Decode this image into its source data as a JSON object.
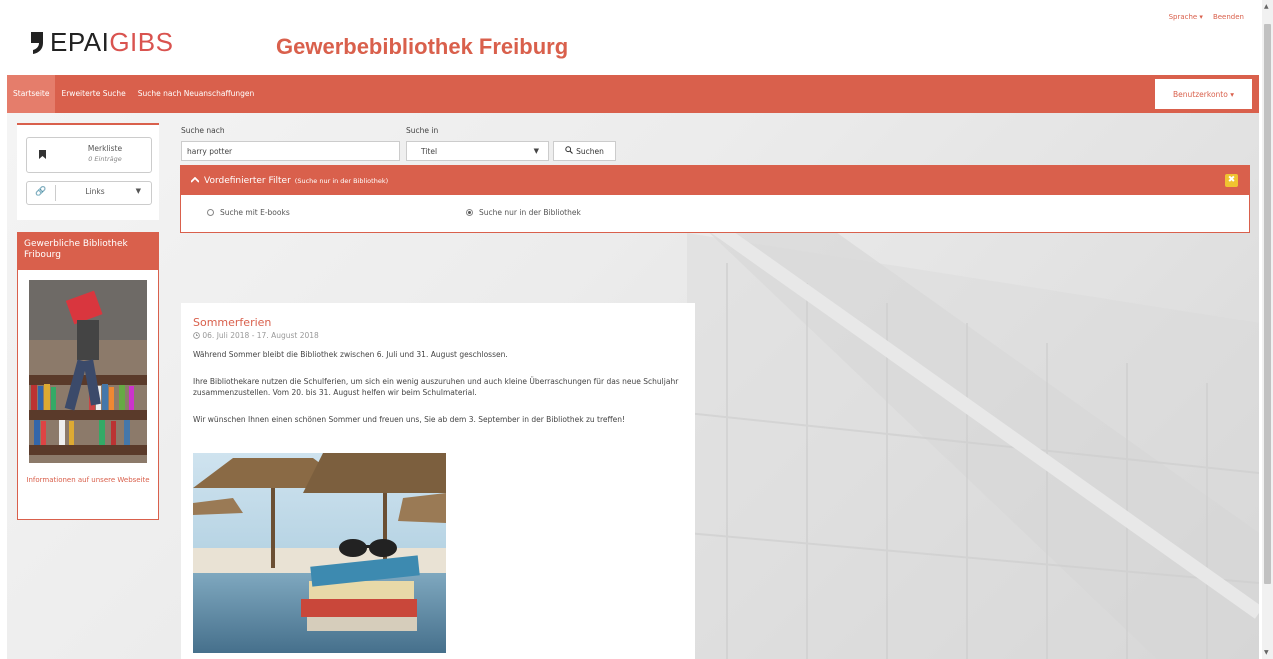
{
  "header": {
    "logo_prefix": "EPAI",
    "logo_accent": "GIBS",
    "site_title": "Gewerbebibliothek Freiburg",
    "language_label": "Sprache ▾",
    "logout_label": "Beenden"
  },
  "nav": {
    "items": [
      {
        "label": "Startseite",
        "active": true
      },
      {
        "label": "Erweiterte Suche",
        "active": false
      },
      {
        "label": "Suche nach Neuanschaffungen",
        "active": false
      }
    ],
    "account_label": "Benutzerkonto ▾"
  },
  "sidebar": {
    "watchlist_label": "Merkliste",
    "watchlist_count": "0 Einträge",
    "links_label": "Links",
    "library_panel_title": "Gewerbliche Bibliothek Fribourg",
    "library_info_link": "Informationen auf unsere Webseite"
  },
  "search": {
    "search_for_label": "Suche nach",
    "query_value": "harry potter",
    "search_in_label": "Suche in",
    "search_in_value": "Titel",
    "button_label": "Suchen"
  },
  "filter": {
    "title": "Vordefinierter Filter",
    "subtitle": "(Suche nur in der Bibliothek)",
    "close_symbol": "✖",
    "options": [
      {
        "label": "Suche mit E-books",
        "selected": false
      },
      {
        "label": "Suche nur in der Bibliothek",
        "selected": true
      }
    ]
  },
  "news": {
    "title": "Sommerferien",
    "date": "06. Juli 2018 - 17. August 2018",
    "paragraphs": [
      "Während Sommer bleibt die Bibliothek zwischen 6. Juli und 31. August geschlossen.",
      "Ihre Bibliothekare nutzen die Schulferien, um sich ein wenig auszuruhen und auch kleine Überraschungen für das neue Schuljahr zusammenzustellen. Vom 20. bis 31. August helfen wir beim Schulmaterial.",
      "Wir wünschen Ihnen einen schönen Sommer und freuen uns, Sie ab dem 3. September in der Bibliothek zu treffen!"
    ]
  },
  "colors": {
    "brand": "#d9604c",
    "warning": "#f0c330"
  }
}
